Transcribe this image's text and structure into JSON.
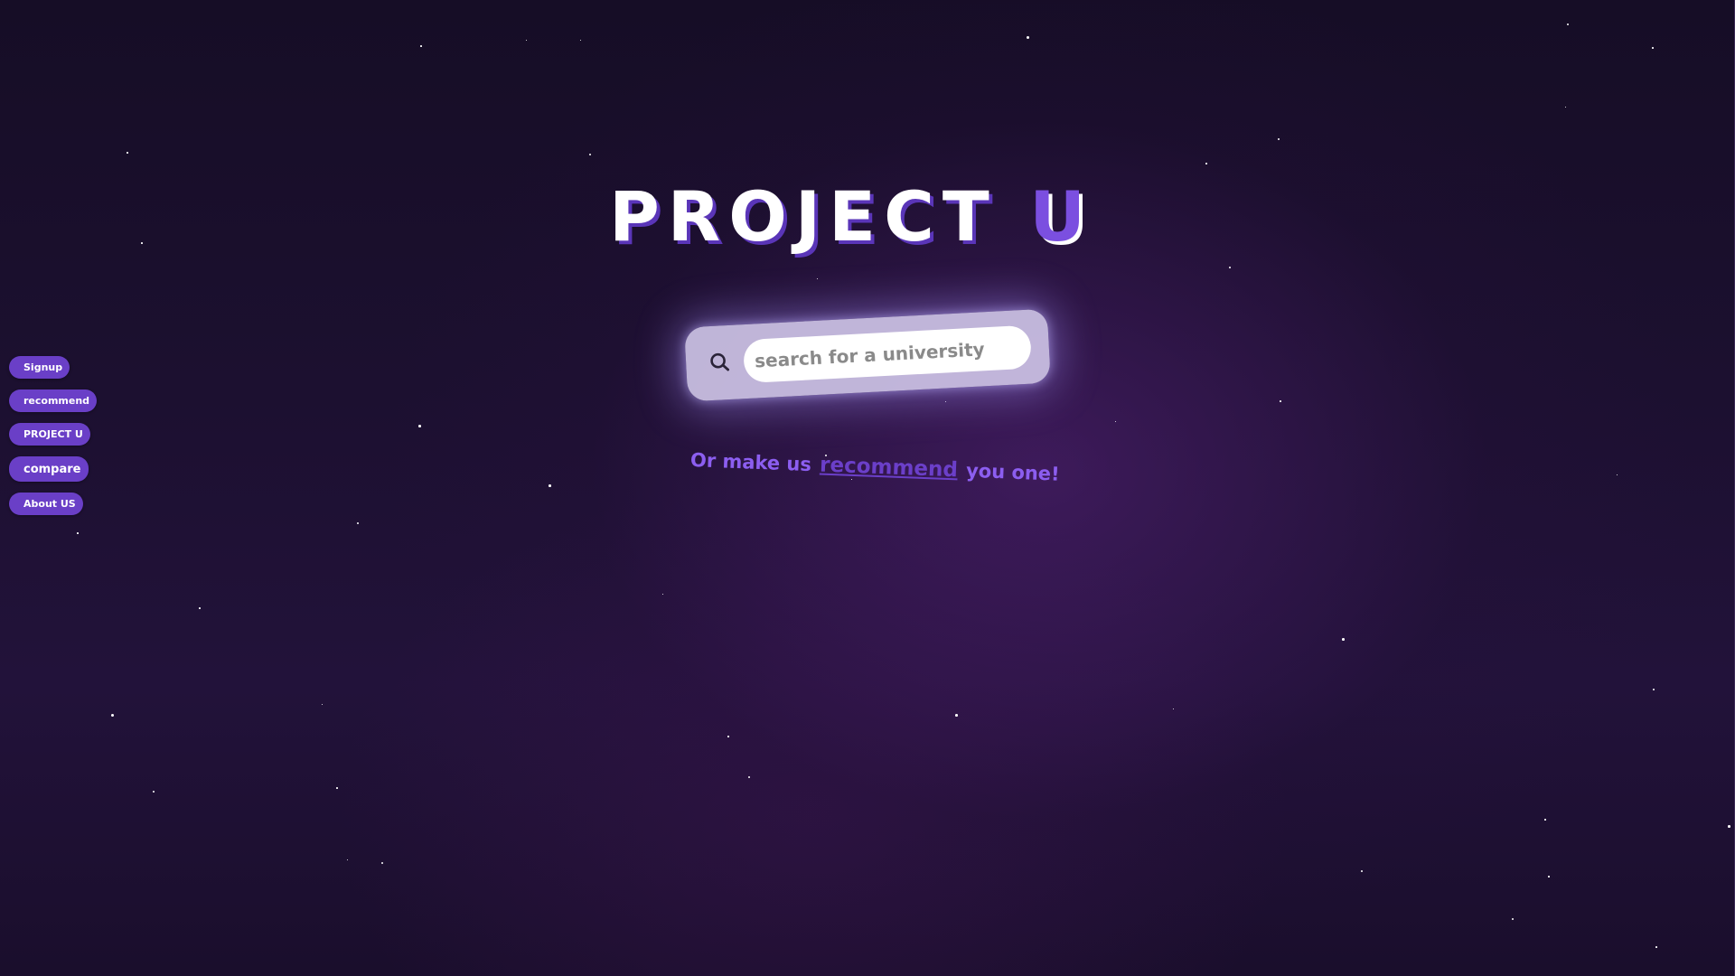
{
  "sidebar": {
    "items": [
      {
        "label": "Signup"
      },
      {
        "label": "recommend"
      },
      {
        "label": "PROJECT U"
      },
      {
        "label": "compare"
      },
      {
        "label": "About US"
      }
    ]
  },
  "hero": {
    "title_main": "PROJECT",
    "title_accent": "U"
  },
  "search": {
    "placeholder": "search for a university",
    "value": ""
  },
  "tagline": {
    "prefix": "Or make us",
    "link": "recommend",
    "suffix": "you one!"
  },
  "colors": {
    "accent": "#7b4fe0",
    "button": "#6a3fc7",
    "background": "#1c1030"
  },
  "icons": {
    "search": "search-icon"
  }
}
